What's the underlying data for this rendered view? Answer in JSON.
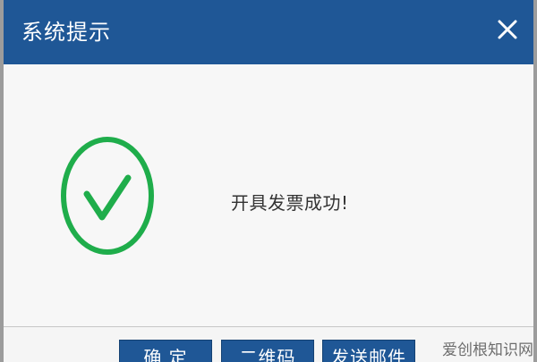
{
  "dialog": {
    "title": "系统提示",
    "message": "开具发票成功!"
  },
  "footer": {
    "buttons": {
      "confirm": "确 定",
      "qrcode": "二维码",
      "send_email": "发送邮件"
    }
  },
  "watermark": {
    "text": "爱创根知识网"
  },
  "colors": {
    "titlebar": "#1f5796",
    "success": "#1fad4b",
    "button": "#1f5796",
    "background": "#f7f7f7"
  },
  "icons": {
    "close": "close-icon",
    "success": "check-circle-icon"
  }
}
